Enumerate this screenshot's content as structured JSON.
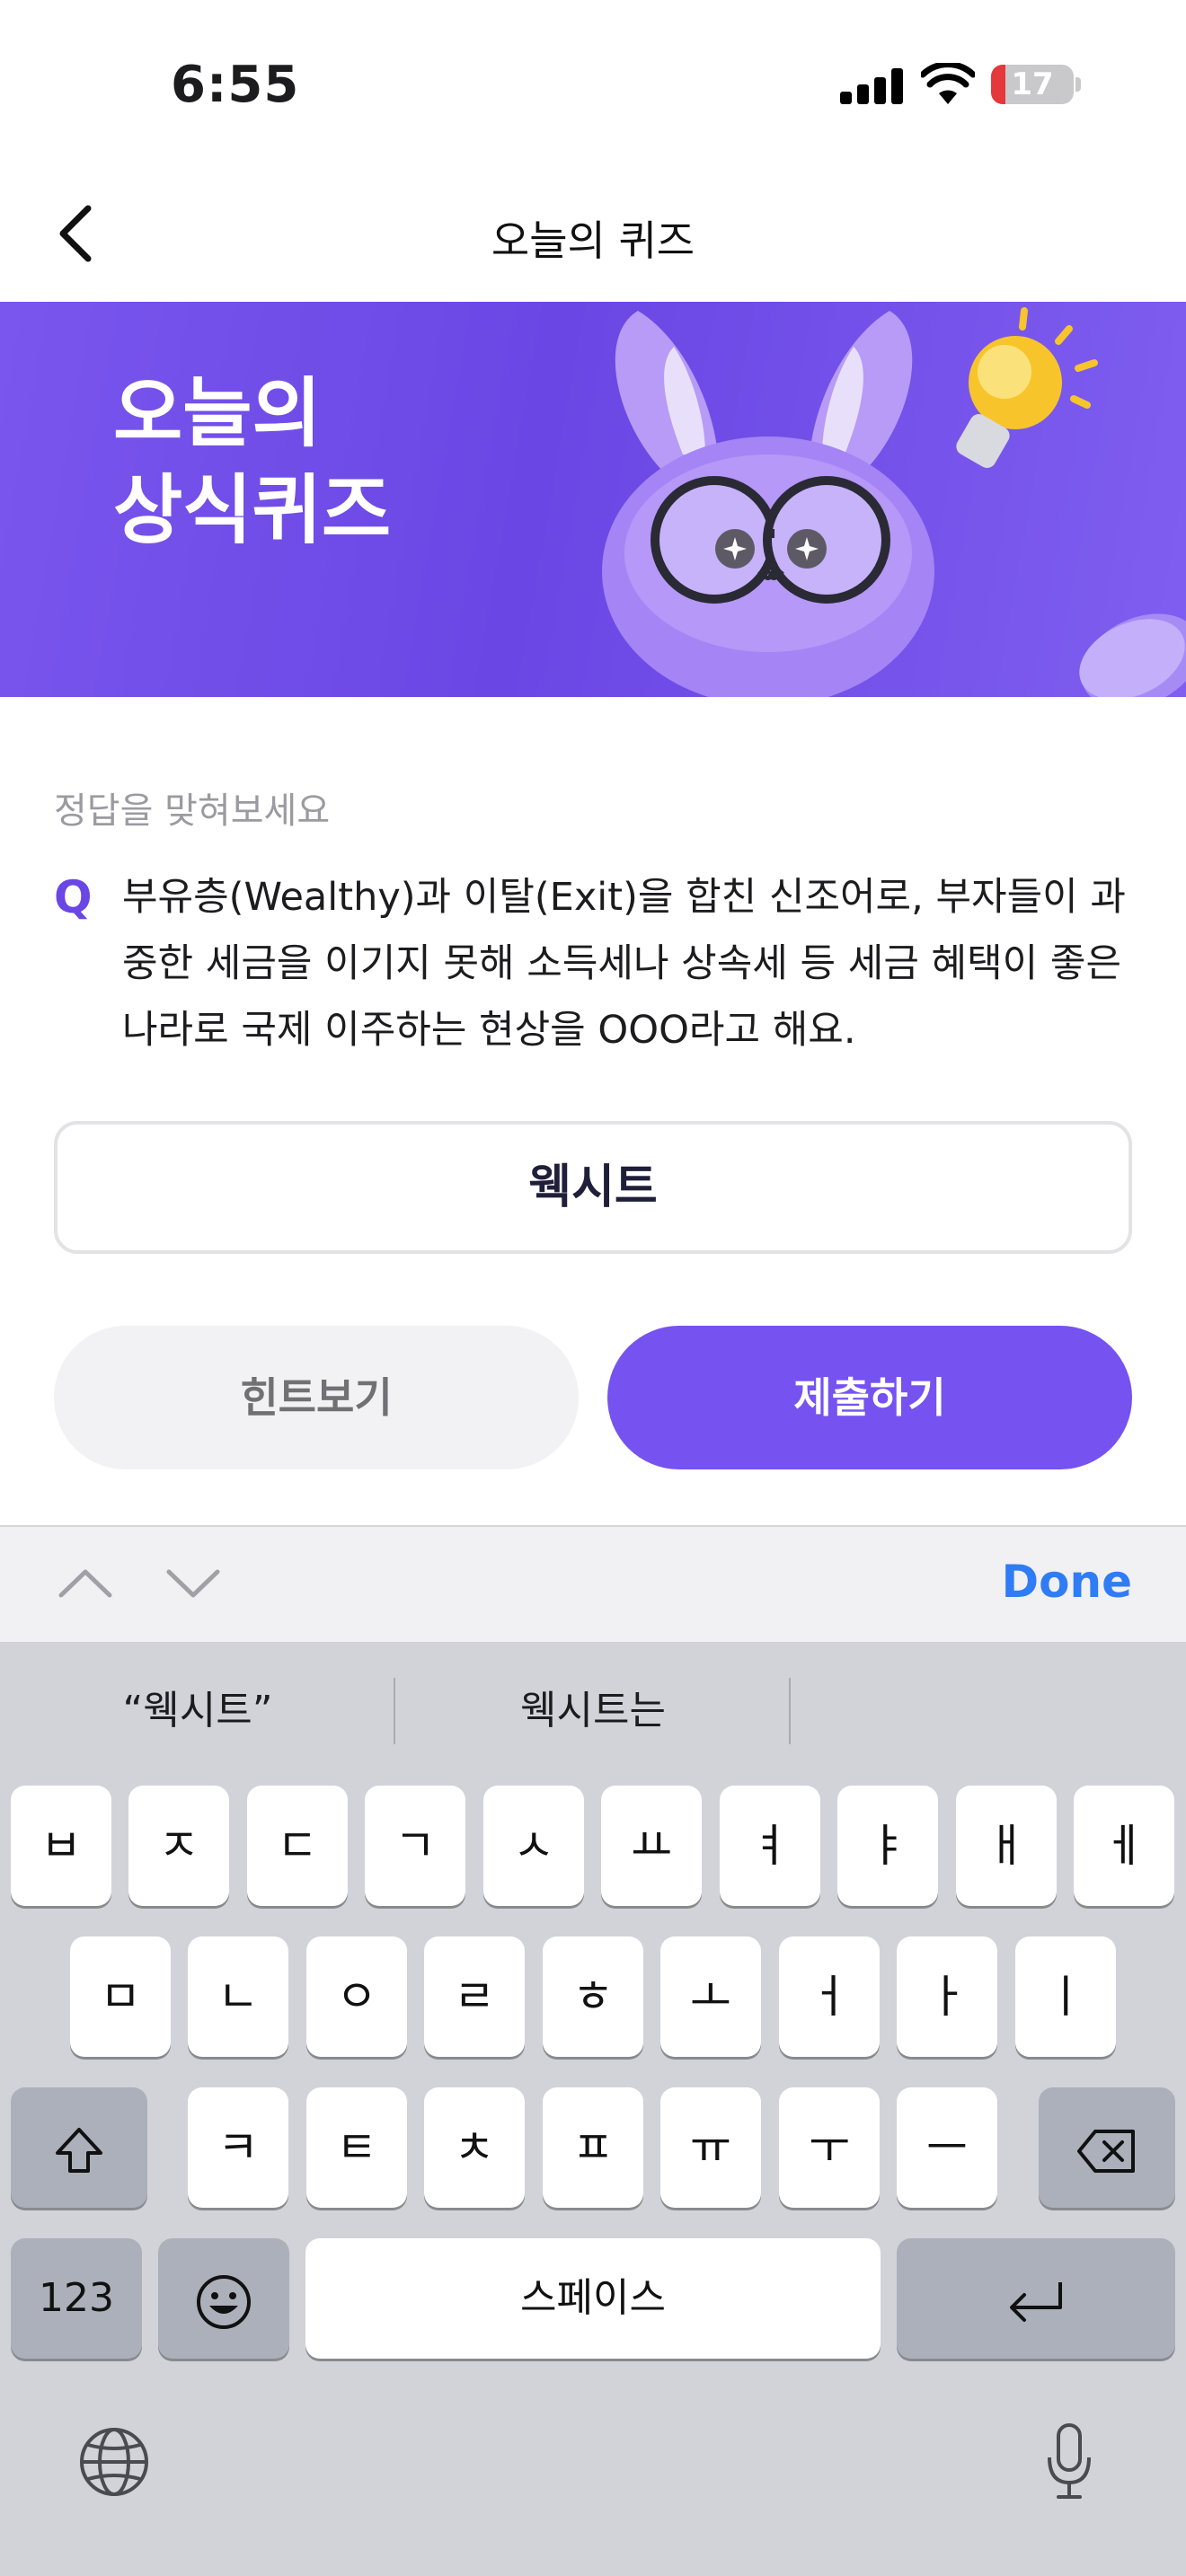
{
  "status_bar": {
    "time": "6:55",
    "battery": "17",
    "battery_level": 0.17
  },
  "nav": {
    "title": "오늘의 퀴즈"
  },
  "banner": {
    "line1": "오늘의",
    "line2": "상식퀴즈"
  },
  "quiz": {
    "label": "정답을 맞혀보세요",
    "q_mark": "Q",
    "question": "부유층(Wealthy)과 이탈(Exit)을 합친 신조어로, 부자들이 과중한 세금을 이기지 못해 소득세나 상속세 등 세금 혜택이 좋은 나라로 국제 이주하는 현상을 OOO라고 해요.",
    "answer_value": "웩시트"
  },
  "buttons": {
    "hint": "힌트보기",
    "submit": "제출하기"
  },
  "accessory": {
    "done": "Done"
  },
  "keyboard": {
    "suggestions": [
      "“웩시트”",
      "웩시트는",
      ""
    ],
    "row1": [
      "ㅂ",
      "ㅈ",
      "ㄷ",
      "ㄱ",
      "ㅅ",
      "ㅛ",
      "ㅕ",
      "ㅑ",
      "ㅐ",
      "ㅔ"
    ],
    "row2": [
      "ㅁ",
      "ㄴ",
      "ㅇ",
      "ㄹ",
      "ㅎ",
      "ㅗ",
      "ㅓ",
      "ㅏ",
      "ㅣ"
    ],
    "row3": [
      "ㅋ",
      "ㅌ",
      "ㅊ",
      "ㅍ",
      "ㅠ",
      "ㅜ",
      "ㅡ"
    ],
    "numbers": "123",
    "space": "스페이스"
  },
  "colors": {
    "accent": "#7652f0",
    "banner": "#6a46e4",
    "done": "#2f7cf6"
  },
  "icons": [
    "back-chevron-icon",
    "signal-icon",
    "wifi-icon",
    "battery-icon",
    "chevron-up-icon",
    "chevron-down-icon",
    "shift-icon",
    "backspace-icon",
    "emoji-icon",
    "return-icon",
    "globe-icon",
    "microphone-icon"
  ]
}
